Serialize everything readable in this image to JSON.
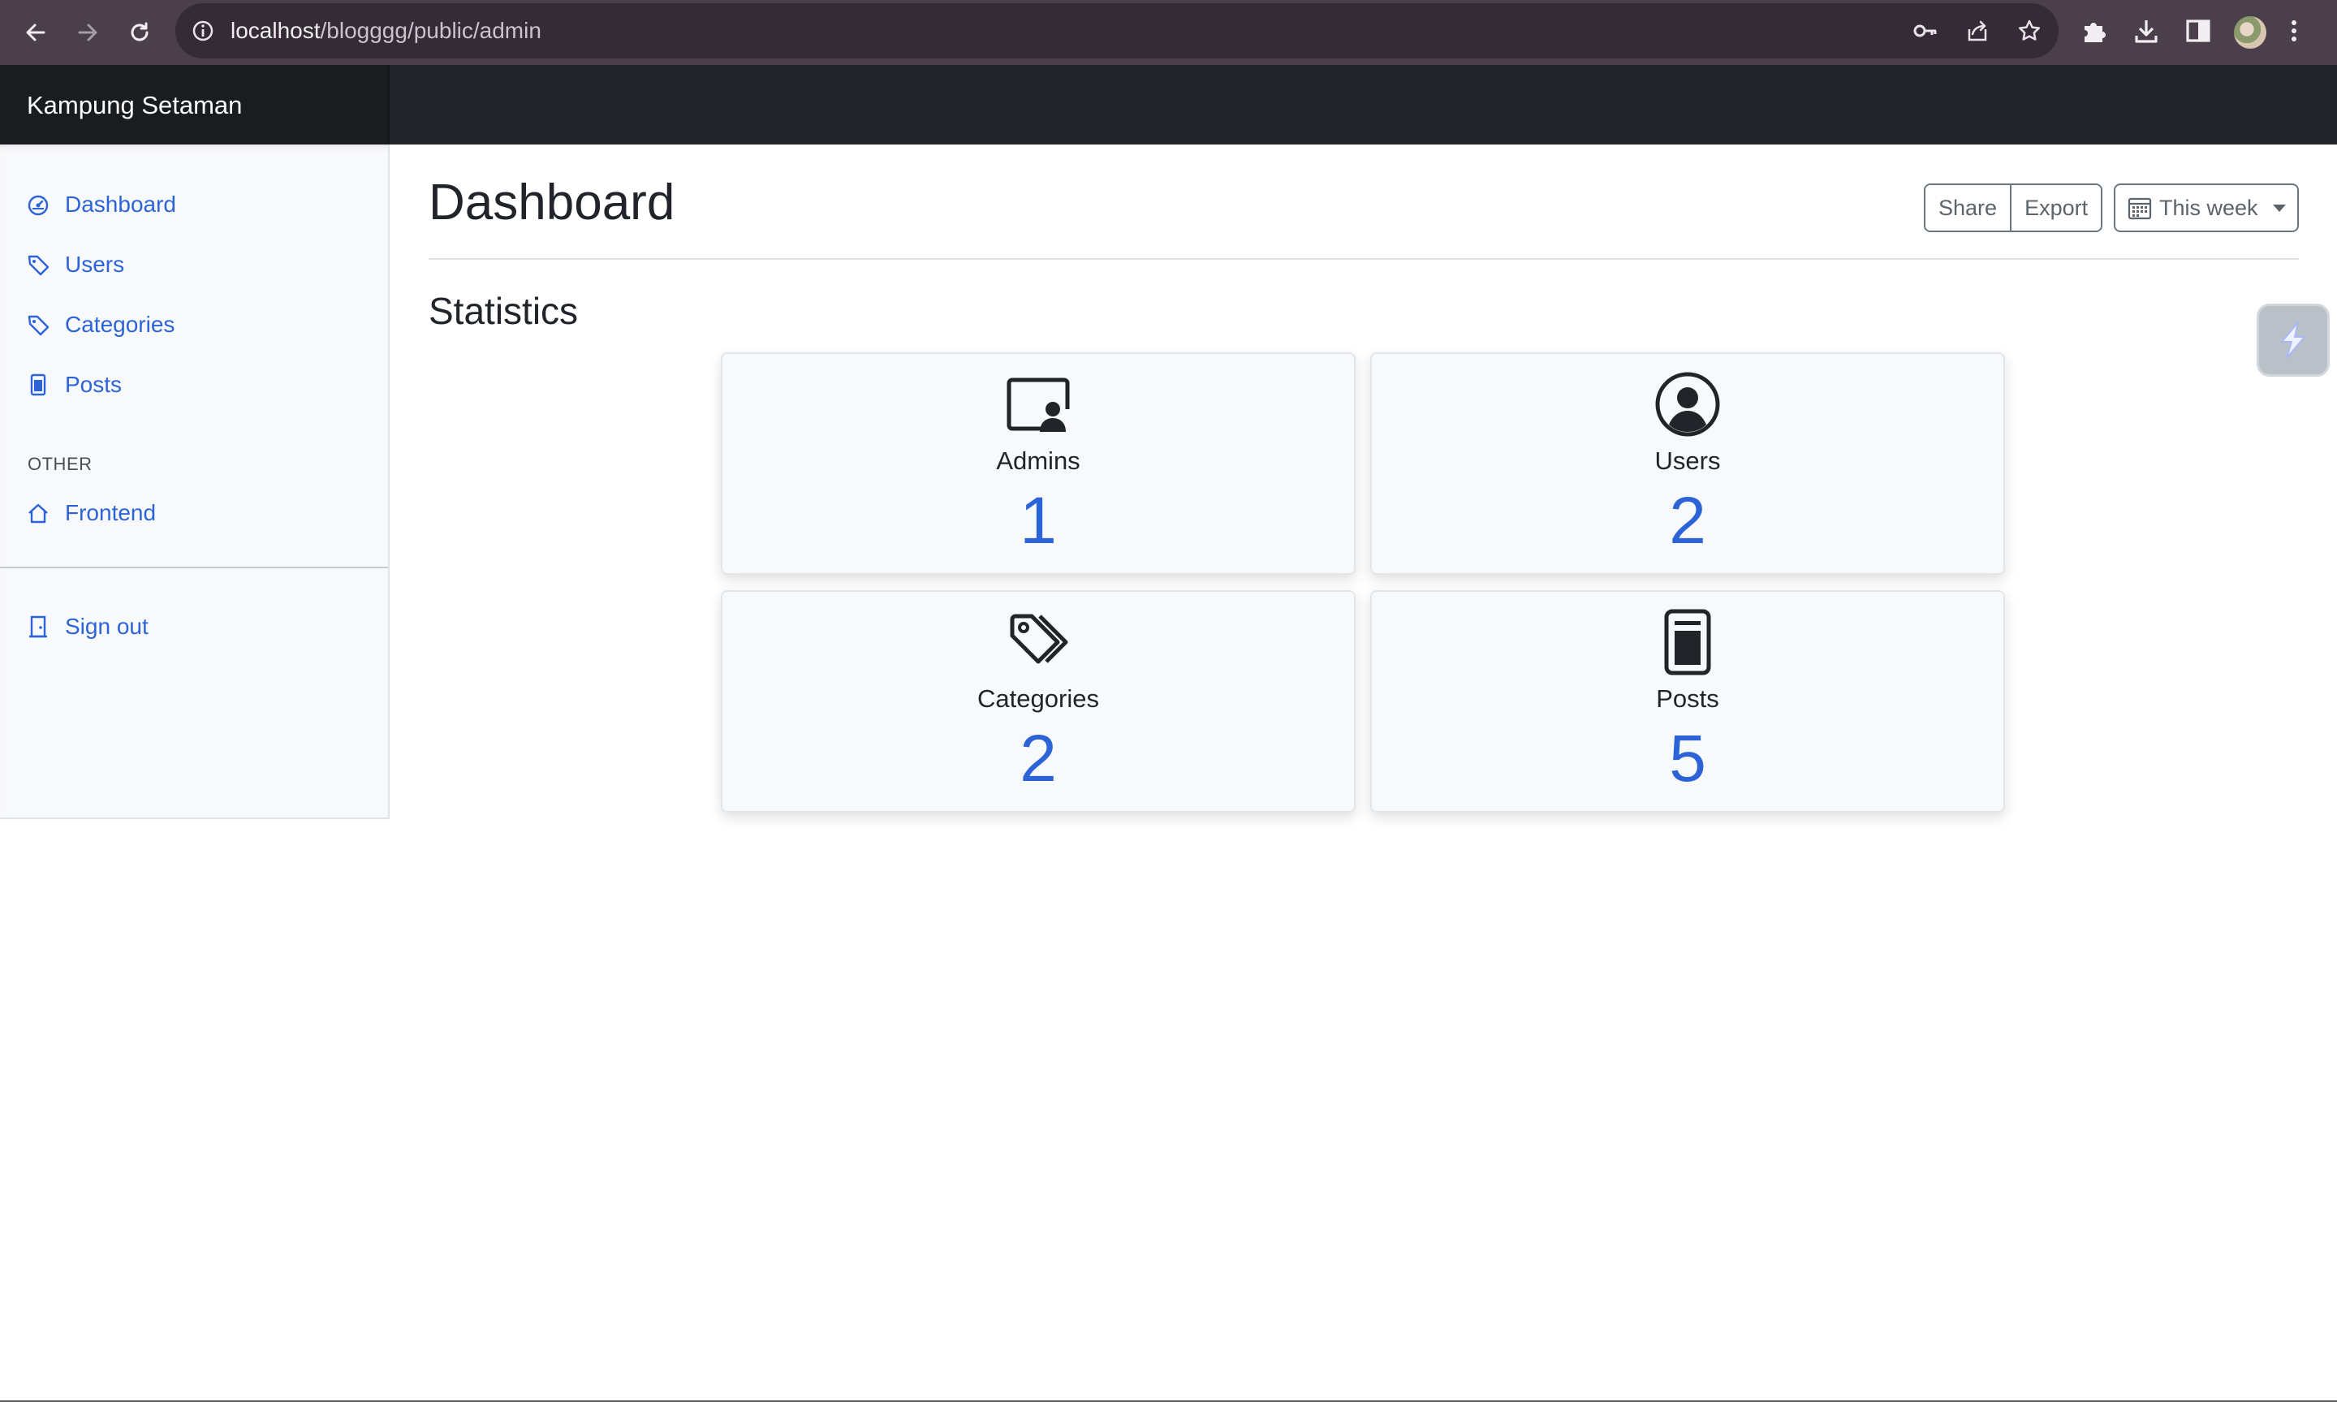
{
  "browser": {
    "url_host": "localhost",
    "url_path": "/blogggg/public/admin",
    "icons": [
      "back-icon",
      "forward-icon",
      "reload-icon",
      "site-info-icon",
      "key-icon",
      "share-icon",
      "star-icon",
      "extensions-icon",
      "download-icon",
      "side-panel-icon",
      "profile-avatar",
      "more-menu-icon"
    ]
  },
  "navbar": {
    "brand": "Kampung Setaman"
  },
  "sidebar": {
    "items": [
      {
        "label": "Dashboard",
        "icon": "speedometer-icon"
      },
      {
        "label": "Users",
        "icon": "tag-icon"
      },
      {
        "label": "Categories",
        "icon": "tag-icon"
      },
      {
        "label": "Posts",
        "icon": "file-icon"
      }
    ],
    "other_heading": "OTHER",
    "other_items": [
      {
        "label": "Frontend",
        "icon": "house-icon"
      }
    ],
    "signout": {
      "label": "Sign out",
      "icon": "door-icon"
    }
  },
  "main": {
    "title": "Dashboard",
    "toolbar": {
      "share": "Share",
      "export": "Export",
      "period": "This week"
    },
    "section_title": "Statistics",
    "stats": [
      {
        "label": "Admins",
        "value": "1",
        "icon": "person-video-icon"
      },
      {
        "label": "Users",
        "value": "2",
        "icon": "person-circle-icon"
      },
      {
        "label": "Categories",
        "value": "2",
        "icon": "tags-icon"
      },
      {
        "label": "Posts",
        "value": "5",
        "icon": "file-text-icon"
      }
    ]
  },
  "colors": {
    "accent": "#2c64d8",
    "navbar": "#212529",
    "sidebar_bg": "#f8f9fa",
    "chrome": "#4a3f4b"
  }
}
